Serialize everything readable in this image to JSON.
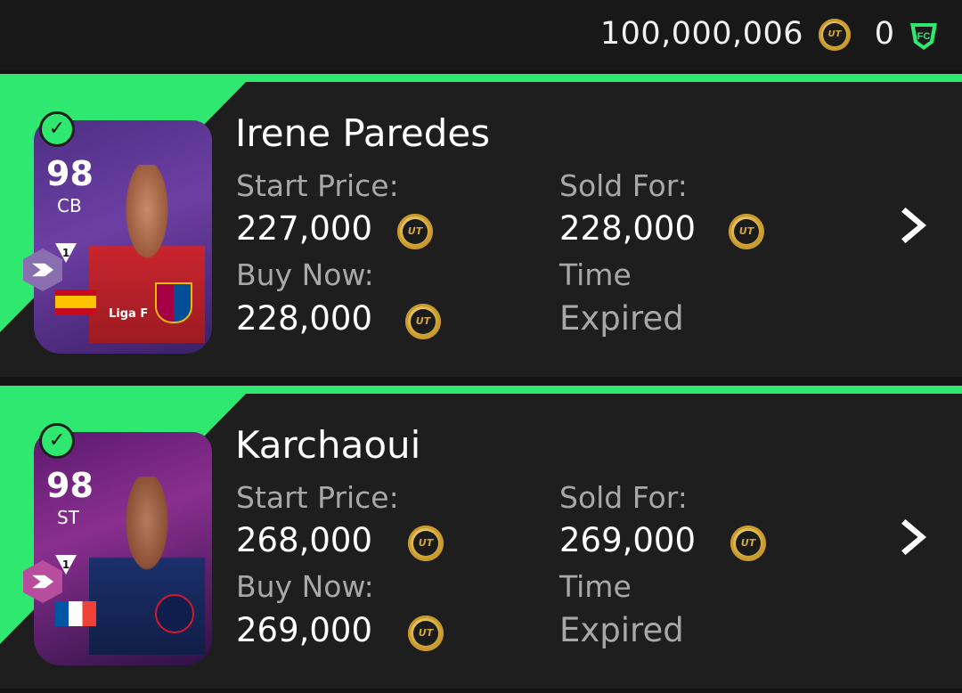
{
  "header": {
    "coins": "100,000,006",
    "points": "0",
    "coin_icon": "ut-coin-icon",
    "points_icon": "fc-points-icon"
  },
  "items": [
    {
      "card": {
        "rating": "98",
        "position": "CB",
        "flag": "spain",
        "league": "Liga F",
        "club": "fc-barcelona",
        "status": "sold"
      },
      "name": "Irene Paredes",
      "start_price_label": "Start Price:",
      "start_price": "227,000",
      "buy_now_label": "Buy Now:",
      "buy_now": "228,000",
      "sold_for_label": "Sold For:",
      "sold_for": "228,000",
      "time_label": "Time",
      "time_value": "Expired"
    },
    {
      "card": {
        "rating": "98",
        "position": "ST",
        "flag": "france",
        "club": "paris-saint-germain",
        "status": "sold"
      },
      "name": "Karchaoui",
      "start_price_label": "Start Price:",
      "start_price": "268,000",
      "buy_now_label": "Buy Now:",
      "buy_now": "269,000",
      "sold_for_label": "Sold For:",
      "sold_for": "269,000",
      "time_label": "Time",
      "time_value": "Expired"
    }
  ],
  "colors": {
    "accent": "#2ee870",
    "background": "#141414",
    "row": "#1e1e1e",
    "muted_text": "#a8a8a8",
    "coin": "#d2a83a"
  }
}
